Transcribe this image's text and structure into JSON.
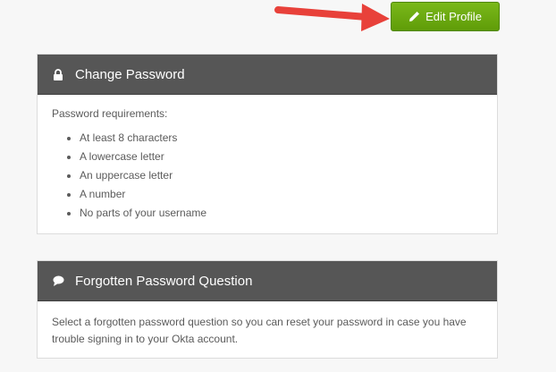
{
  "header": {
    "edit_profile_label": "Edit Profile"
  },
  "change_password": {
    "title": "Change Password",
    "requirements_label": "Password requirements:",
    "requirements": [
      "At least 8 characters",
      "A lowercase letter",
      "An uppercase letter",
      "A number",
      "No parts of your username"
    ]
  },
  "forgotten_question": {
    "title": "Forgotten Password Question",
    "description": "Select a forgotten password question so you can reset your password in case you have trouble signing in to your Okta account."
  },
  "colors": {
    "accent_green": "#6aab0f",
    "panel_header": "#565656",
    "annotation_arrow": "#e8413a"
  },
  "icons": {
    "edit": "pencil-icon",
    "lock": "lock-icon",
    "question": "speech-bubble-icon"
  }
}
